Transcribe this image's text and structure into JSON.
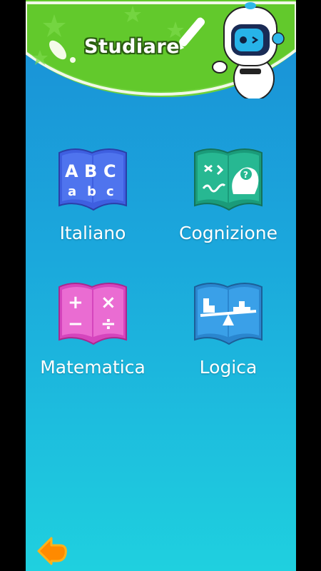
{
  "header": {
    "title": "Studiare"
  },
  "subjects": [
    {
      "label": "Italiano",
      "icon": "abc-book-icon",
      "color": "#3f5fe0",
      "glyphs": [
        "A",
        "B",
        "C",
        "a",
        "b",
        "c"
      ]
    },
    {
      "label": "Cognizione",
      "icon": "brain-book-icon",
      "color": "#1fae8c"
    },
    {
      "label": "Matematica",
      "icon": "math-book-icon",
      "color": "#e25bc8",
      "glyphs": [
        "+",
        "×",
        "−",
        "÷"
      ]
    },
    {
      "label": "Logica",
      "icon": "balance-book-icon",
      "color": "#2f8fd8"
    }
  ],
  "navigation": {
    "back_icon": "back-arrow-icon",
    "back_color": "#ff8a00"
  }
}
